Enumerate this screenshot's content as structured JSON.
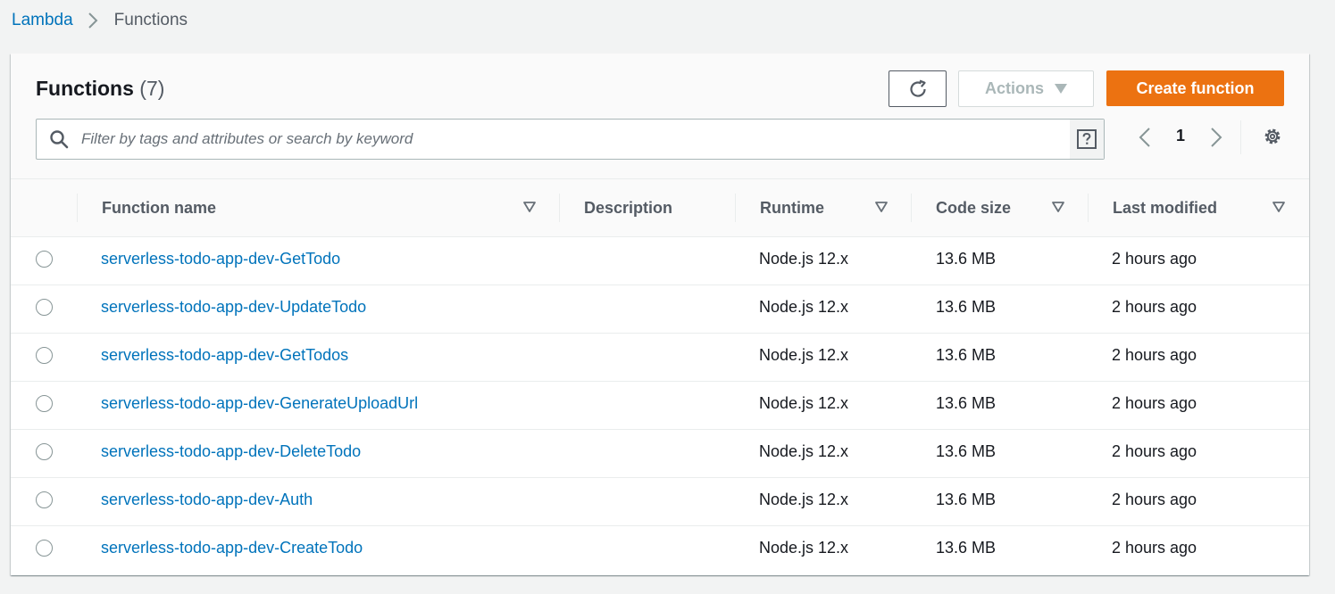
{
  "breadcrumb": {
    "root": "Lambda",
    "current": "Functions"
  },
  "panel": {
    "title": "Functions",
    "count": "(7)"
  },
  "toolbar": {
    "actions_label": "Actions",
    "create_label": "Create function"
  },
  "search": {
    "placeholder": "Filter by tags and attributes or search by keyword"
  },
  "pagination": {
    "current_page": "1"
  },
  "columns": {
    "name": "Function name",
    "description": "Description",
    "runtime": "Runtime",
    "code_size": "Code size",
    "last_modified": "Last modified"
  },
  "rows": [
    {
      "name": "serverless-todo-app-dev-GetTodo",
      "description": "",
      "runtime": "Node.js 12.x",
      "code_size": "13.6 MB",
      "last_modified": "2 hours ago"
    },
    {
      "name": "serverless-todo-app-dev-UpdateTodo",
      "description": "",
      "runtime": "Node.js 12.x",
      "code_size": "13.6 MB",
      "last_modified": "2 hours ago"
    },
    {
      "name": "serverless-todo-app-dev-GetTodos",
      "description": "",
      "runtime": "Node.js 12.x",
      "code_size": "13.6 MB",
      "last_modified": "2 hours ago"
    },
    {
      "name": "serverless-todo-app-dev-GenerateUploadUrl",
      "description": "",
      "runtime": "Node.js 12.x",
      "code_size": "13.6 MB",
      "last_modified": "2 hours ago"
    },
    {
      "name": "serverless-todo-app-dev-DeleteTodo",
      "description": "",
      "runtime": "Node.js 12.x",
      "code_size": "13.6 MB",
      "last_modified": "2 hours ago"
    },
    {
      "name": "serverless-todo-app-dev-Auth",
      "description": "",
      "runtime": "Node.js 12.x",
      "code_size": "13.6 MB",
      "last_modified": "2 hours ago"
    },
    {
      "name": "serverless-todo-app-dev-CreateTodo",
      "description": "",
      "runtime": "Node.js 12.x",
      "code_size": "13.6 MB",
      "last_modified": "2 hours ago"
    }
  ],
  "icons": {
    "breadcrumb_sep": "chevron-right-icon",
    "refresh": "refresh-icon",
    "actions_caret": "caret-down-icon",
    "search": "search-icon",
    "help": "help-icon",
    "prev": "chevron-left-icon",
    "next": "chevron-right-icon",
    "settings": "gear-icon",
    "sort": "sort-caret-icon"
  },
  "colors": {
    "link": "#0073bb",
    "primary_button": "#ec7211",
    "page_background": "#f2f3f3",
    "header_background": "#fafafa",
    "text": "#16191f",
    "muted_text": "#545b64"
  }
}
